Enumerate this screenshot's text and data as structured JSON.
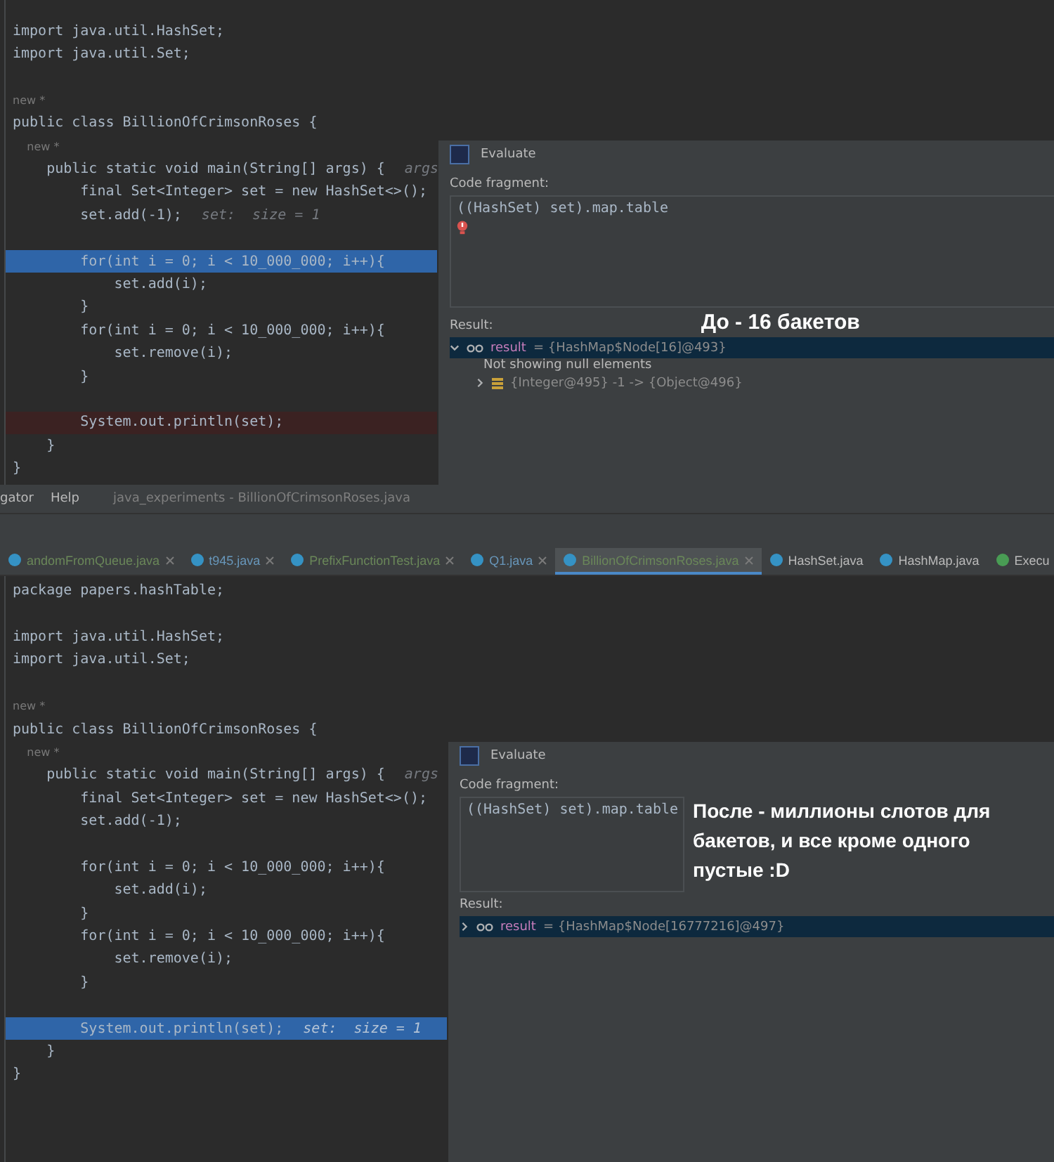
{
  "top_panel": {
    "editor": {
      "lines": [
        {
          "kind": "code",
          "text": "import java.util.HashSet;"
        },
        {
          "kind": "code",
          "text": "import java.util.Set;"
        },
        {
          "kind": "blank"
        },
        {
          "kind": "annotation",
          "text": "new *"
        },
        {
          "kind": "code",
          "text": "public class BillionOfCrimsonRoses {"
        },
        {
          "kind": "annotation",
          "text": "    new *"
        },
        {
          "kind": "code",
          "text": "    public static void main(String[] args) {",
          "hint": "args"
        },
        {
          "kind": "code",
          "text": "        final Set<Integer> set = new HashSet<>();"
        },
        {
          "kind": "code",
          "text": "        set.add(-1);",
          "hint": "set:  size = 1"
        },
        {
          "kind": "blank"
        },
        {
          "kind": "current",
          "text": "        for(int i = 0; i < 10_000_000; i++){"
        },
        {
          "kind": "code",
          "text": "            set.add(i);"
        },
        {
          "kind": "code",
          "text": "        }"
        },
        {
          "kind": "code",
          "text": "        for(int i = 0; i < 10_000_000; i++){"
        },
        {
          "kind": "code",
          "text": "            set.remove(i);"
        },
        {
          "kind": "code",
          "text": "        }"
        },
        {
          "kind": "blank"
        },
        {
          "kind": "breakpoint",
          "text": "        System.out.println(set);"
        },
        {
          "kind": "code",
          "text": "    }"
        },
        {
          "kind": "code",
          "text": "}"
        }
      ]
    },
    "dialog": {
      "title": "Evaluate",
      "fragment_label": "Code fragment:",
      "fragment": "((HashSet) set).map.table",
      "error": true,
      "result_label": "Result:",
      "results": [
        {
          "kind": "node",
          "name": "result",
          "value": "= {HashMap$Node[16]@493}",
          "expanded": true,
          "selected": true,
          "children": [
            {
              "kind": "note",
              "text": "Not showing null elements"
            },
            {
              "kind": "entry",
              "text": "{Integer@495} -1 -> {Object@496}",
              "expanded": false,
              "selected": false
            }
          ]
        }
      ]
    },
    "caption": "До - 16 бакетов"
  },
  "menu_bar": {
    "items": [
      "gator",
      "Help"
    ],
    "title": "java_experiments - BillionOfCrimsonRoses.java"
  },
  "editor_tabs": [
    {
      "label": "andomFromQueue.java",
      "selected": false,
      "closable": true,
      "color": "#6a8759",
      "kind": "class"
    },
    {
      "label": "t945.java",
      "selected": false,
      "closable": true,
      "color": "#6897bb",
      "kind": "class"
    },
    {
      "label": "PrefixFunctionTest.java",
      "selected": false,
      "closable": true,
      "color": "#6a8759",
      "kind": "class"
    },
    {
      "label": "Q1.java",
      "selected": false,
      "closable": true,
      "color": "#6897bb",
      "kind": "class"
    },
    {
      "label": "BillionOfCrimsonRoses.java",
      "selected": true,
      "closable": true,
      "color": "#6a8759",
      "kind": "class"
    },
    {
      "label": "HashSet.java",
      "selected": false,
      "closable": false,
      "color": "#bbbbbb",
      "kind": "class"
    },
    {
      "label": "HashMap.java",
      "selected": false,
      "closable": false,
      "color": "#bbbbbb",
      "kind": "class"
    },
    {
      "label": "Execu",
      "selected": false,
      "closable": false,
      "color": "#bbbbbb",
      "kind": "run"
    }
  ],
  "bottom_panel": {
    "editor": {
      "lines": [
        {
          "kind": "code",
          "text": "package papers.hashTable;"
        },
        {
          "kind": "blank"
        },
        {
          "kind": "code",
          "text": "import java.util.HashSet;"
        },
        {
          "kind": "code",
          "text": "import java.util.Set;"
        },
        {
          "kind": "blank"
        },
        {
          "kind": "annotation",
          "text": "new *"
        },
        {
          "kind": "code",
          "text": "public class BillionOfCrimsonRoses {"
        },
        {
          "kind": "annotation",
          "text": "    new *"
        },
        {
          "kind": "code",
          "text": "    public static void main(String[] args) {",
          "hint": "args"
        },
        {
          "kind": "code",
          "text": "        final Set<Integer> set = new HashSet<>();"
        },
        {
          "kind": "code",
          "text": "        set.add(-1);"
        },
        {
          "kind": "blank"
        },
        {
          "kind": "code",
          "text": "        for(int i = 0; i < 10_000_000; i++){"
        },
        {
          "kind": "code",
          "text": "            set.add(i);"
        },
        {
          "kind": "code",
          "text": "        }"
        },
        {
          "kind": "code",
          "text": "        for(int i = 0; i < 10_000_000; i++){"
        },
        {
          "kind": "code",
          "text": "            set.remove(i);"
        },
        {
          "kind": "code",
          "text": "        }"
        },
        {
          "kind": "blank"
        },
        {
          "kind": "current",
          "text": "        System.out.println(set);",
          "hint": "set:  size = 1"
        },
        {
          "kind": "code",
          "text": "    }"
        },
        {
          "kind": "code",
          "text": "}"
        }
      ]
    },
    "dialog": {
      "title": "Evaluate",
      "fragment_label": "Code fragment:",
      "fragment": "((HashSet) set).map.table",
      "error": false,
      "result_label": "Result:",
      "results": [
        {
          "kind": "node",
          "name": "result",
          "value": "= {HashMap$Node[16777216]@497}",
          "expanded": false,
          "selected": true
        }
      ]
    },
    "caption": "После - миллионы слотов для бакетов, и все кроме одного пустые :D"
  }
}
